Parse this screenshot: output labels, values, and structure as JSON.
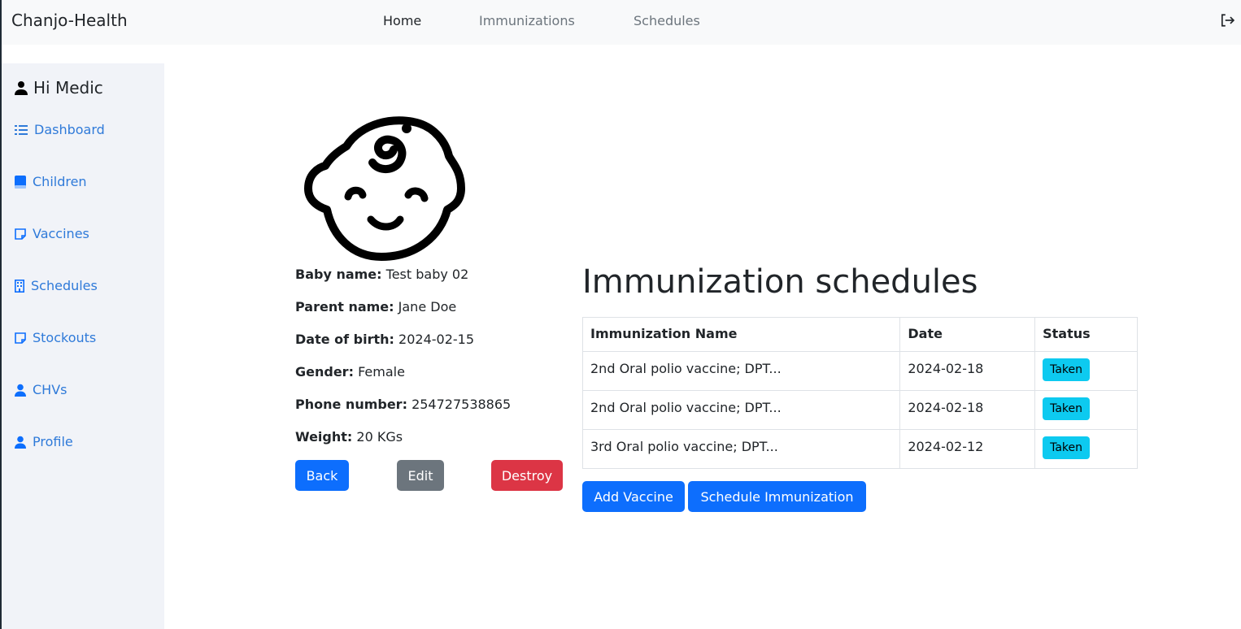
{
  "navbar": {
    "brand": "Chanjo-Health",
    "links": [
      {
        "label": "Home",
        "active": true
      },
      {
        "label": "Immunizations",
        "active": false
      },
      {
        "label": "Schedules",
        "active": false
      }
    ],
    "logout_icon": "box-arrow-right-icon"
  },
  "sidebar": {
    "greeting": "Hi Medic",
    "items": [
      {
        "label": "Dashboard",
        "icon": "list-icon"
      },
      {
        "label": "Children",
        "icon": "book-icon"
      },
      {
        "label": "Vaccines",
        "icon": "sticky-note-icon"
      },
      {
        "label": "Schedules",
        "icon": "building-icon"
      },
      {
        "label": "Stockouts",
        "icon": "sticky-note-icon"
      },
      {
        "label": "CHVs",
        "icon": "person-icon"
      },
      {
        "label": "Profile",
        "icon": "person-icon"
      }
    ]
  },
  "child": {
    "fields": [
      {
        "label": "Baby name:",
        "value": "Test baby 02"
      },
      {
        "label": "Parent name:",
        "value": "Jane Doe"
      },
      {
        "label": "Date of birth:",
        "value": "2024-02-15"
      },
      {
        "label": "Gender:",
        "value": "Female"
      },
      {
        "label": "Phone number:",
        "value": "254727538865"
      },
      {
        "label": "Weight:",
        "value": "20 KGs"
      }
    ],
    "buttons": {
      "back": "Back",
      "edit": "Edit",
      "destroy": "Destroy"
    }
  },
  "schedules": {
    "title": "Immunization schedules",
    "columns": [
      "Immunization Name",
      "Date",
      "Status"
    ],
    "rows": [
      {
        "name": "2nd Oral polio vaccine; DPT...",
        "date": "2024-02-18",
        "status": "Taken"
      },
      {
        "name": "2nd Oral polio vaccine; DPT...",
        "date": "2024-02-18",
        "status": "Taken"
      },
      {
        "name": "3rd Oral polio vaccine; DPT...",
        "date": "2024-02-12",
        "status": "Taken"
      }
    ],
    "buttons": {
      "add_vaccine": "Add Vaccine",
      "schedule": "Schedule Immunization"
    }
  },
  "colors": {
    "primary": "#0d6efd",
    "secondary": "#6c757d",
    "danger": "#dc3545",
    "info": "#0dcaf0",
    "sidebar_link": "#2f7ad9"
  }
}
